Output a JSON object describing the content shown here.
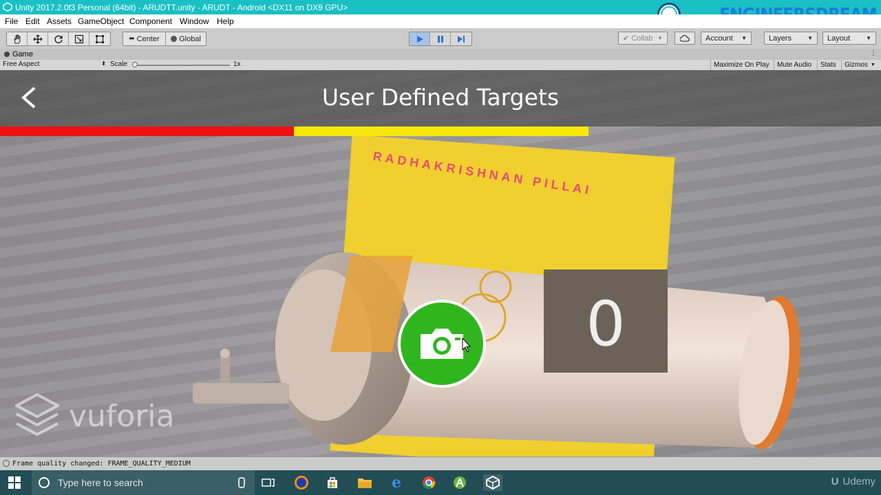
{
  "window": {
    "title": "Unity 2017.2.0f3 Personal (64bit) - ARUDTT.unity - ARUDT - Android <DX11 on DX9 GPU>"
  },
  "watermark": {
    "text": "ENGINEERSDREAM"
  },
  "menu": [
    "File",
    "Edit",
    "Assets",
    "GameObject",
    "Component",
    "Window",
    "Help"
  ],
  "toolbar": {
    "pivot": "Center",
    "space": "Global",
    "collab": "Collab",
    "account": "Account",
    "layers": "Layers",
    "layout": "Layout"
  },
  "game_tab": {
    "label": "Game"
  },
  "game_bar": {
    "aspect": "Free Aspect",
    "scale_label": "Scale",
    "scale_value": "1x",
    "maximize": "Maximize On Play",
    "mute": "Mute Audio",
    "stats": "Stats",
    "gizmos": "Gizmos"
  },
  "app": {
    "title": "User Defined Targets",
    "brand": "vuforia",
    "book_text": "RADHAKRISHNAN PILLAI"
  },
  "status": {
    "message": "Frame quality changed: FRAME_QUALITY_MEDIUM"
  },
  "taskbar": {
    "search_placeholder": "Type here to search",
    "udemy": "Udemy"
  },
  "colors": {
    "titlebar": "#19c0c4",
    "progress_red": "#ee1010",
    "progress_yellow": "#f7e70b",
    "camera_button": "#31b51f"
  }
}
